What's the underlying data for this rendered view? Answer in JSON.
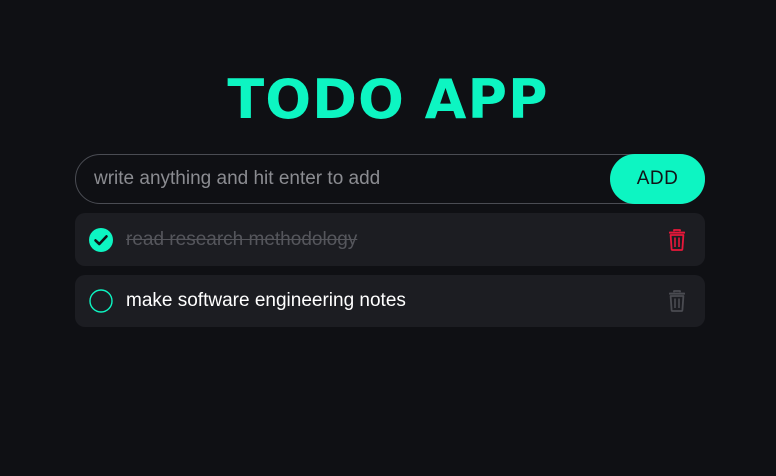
{
  "app": {
    "title": "TODO APP",
    "accent_color": "#0df5c2",
    "background_color": "#0f1014"
  },
  "form": {
    "input_value": "",
    "input_placeholder": "write anything and hit enter to add",
    "add_button_label": "ADD"
  },
  "todos": [
    {
      "text": "read research methodology",
      "completed": true,
      "check_icon": "check-circle-filled-icon",
      "delete_icon": "trash-icon",
      "delete_icon_color": "#e8173a"
    },
    {
      "text": "make software engineering notes",
      "completed": false,
      "check_icon": "circle-outline-icon",
      "delete_icon": "trash-icon",
      "delete_icon_color": "#4a4b51"
    }
  ]
}
